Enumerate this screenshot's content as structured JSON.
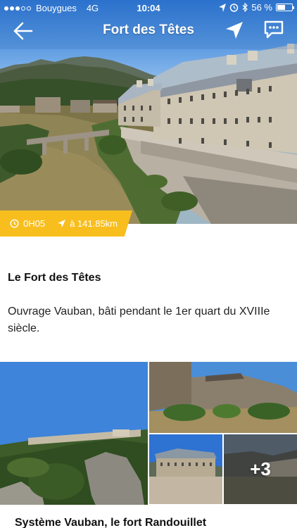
{
  "status_bar": {
    "carrier": "Bouygues",
    "network": "4G",
    "time": "10:04",
    "battery": "56 %",
    "battery_level": 0.56
  },
  "nav": {
    "title": "Fort des Têtes",
    "back_icon": "arrow-left-icon",
    "locate_icon": "navigation-arrow-icon",
    "comment_icon": "comment-icon"
  },
  "info_badge": {
    "duration": "0H05",
    "distance": "à 141.85km",
    "color": "#f8be1e"
  },
  "place": {
    "title": "Le Fort des Têtes",
    "description": "Ouvrage Vauban, bâti pendant le 1er quart du XVIIIe siècle."
  },
  "gallery": {
    "more_count": "+3",
    "next_caption": "Système Vauban, le fort Randouillet"
  }
}
